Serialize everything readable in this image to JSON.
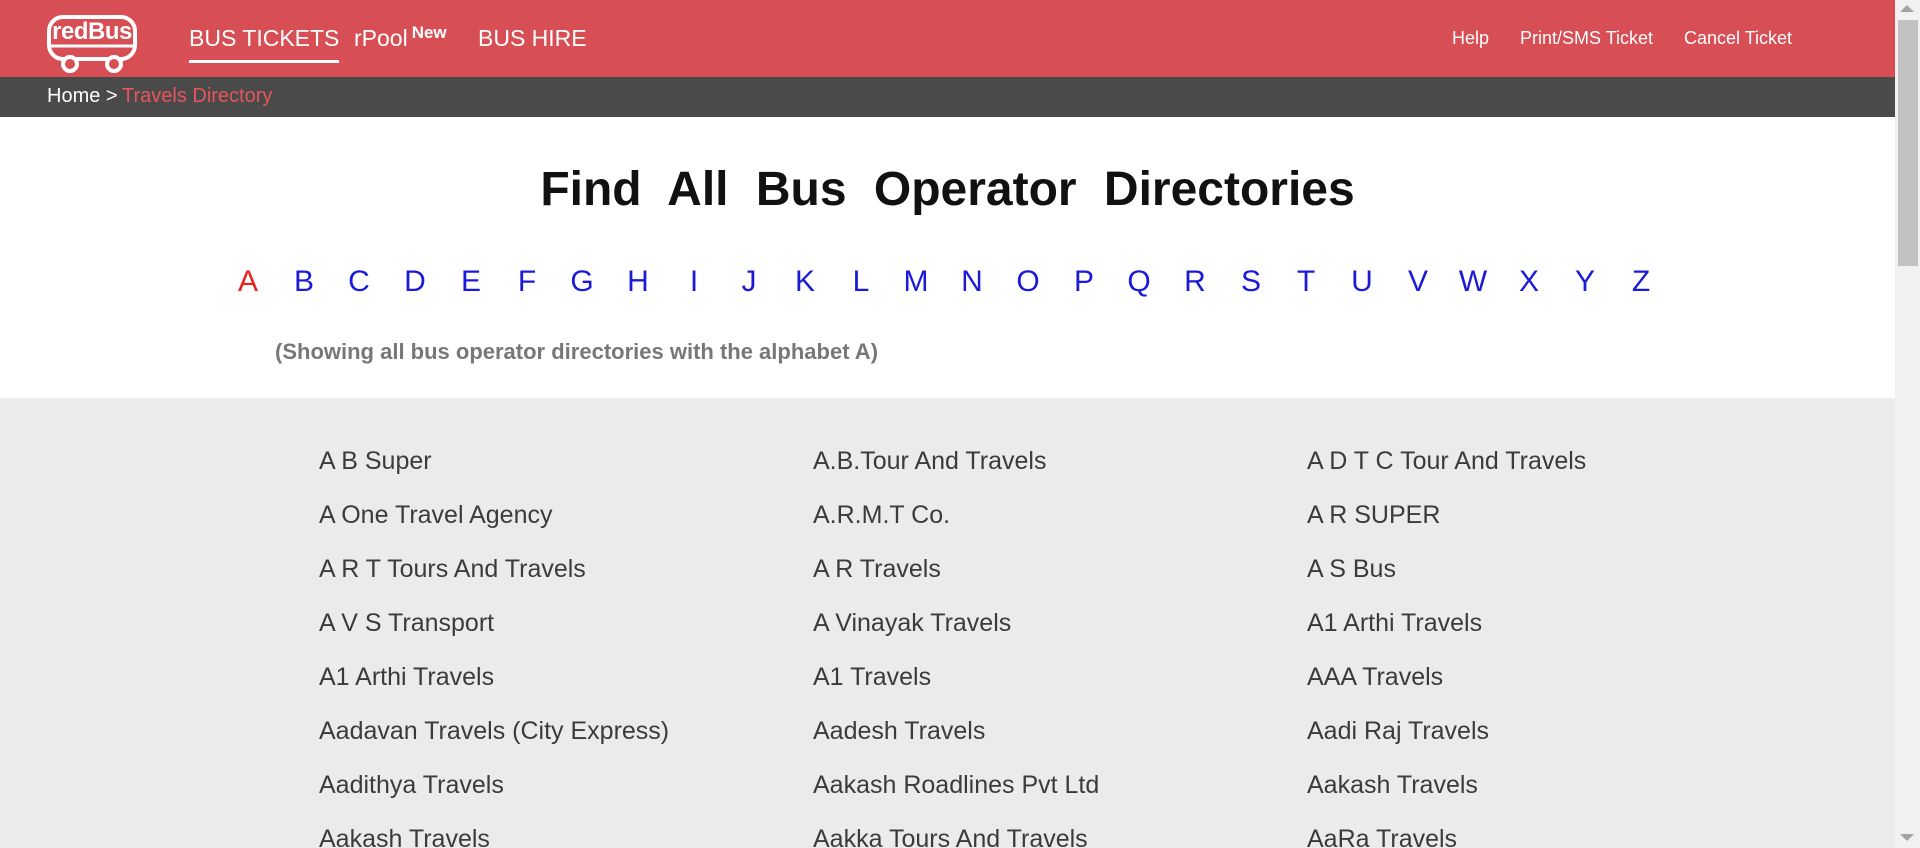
{
  "header": {
    "logo_text": "redBus",
    "nav": [
      {
        "label": "BUS TICKETS"
      },
      {
        "label": "rPool",
        "badge": "New"
      },
      {
        "label": "BUS HIRE"
      }
    ],
    "links": [
      "Help",
      "Print/SMS Ticket",
      "Cancel Ticket"
    ]
  },
  "breadcrumb": {
    "home": "Home >",
    "current": "Travels Directory"
  },
  "main": {
    "title": "Find All Bus Operator Directories",
    "alphabet": [
      "A",
      "B",
      "C",
      "D",
      "E",
      "F",
      "G",
      "H",
      "I",
      "J",
      "K",
      "L",
      "M",
      "N",
      "O",
      "P",
      "Q",
      "R",
      "S",
      "T",
      "U",
      "V",
      "W",
      "X",
      "Y",
      "Z"
    ],
    "selected_letter": "A",
    "showing_note": "(Showing all bus operator directories with the alphabet A)"
  },
  "operators": [
    "A B Super",
    "A.B.Tour And Travels",
    "A D T C Tour And Travels",
    "A One Travel Agency",
    "A.R.M.T Co.",
    "A R SUPER",
    "A R T Tours And Travels",
    "A R Travels",
    "A S Bus",
    "A V S Transport",
    "A Vinayak Travels",
    "A1 Arthi Travels",
    "A1 Arthi Travels",
    "A1 Travels",
    "AAA Travels",
    "Aadavan Travels (City Express)",
    "Aadesh Travels",
    "Aadi Raj Travels",
    "Aadithya Travels",
    "Aakash Roadlines Pvt Ltd",
    "Aakash Travels",
    "Aakash Travels",
    "Aakka Tours And Travels",
    "AaRa Travels"
  ],
  "colors": {
    "brand": "#d84e55",
    "breadcrumb_bar": "#4a4a4a",
    "link_blue": "#1a1ad8",
    "selected_letter": "#e8201e"
  }
}
